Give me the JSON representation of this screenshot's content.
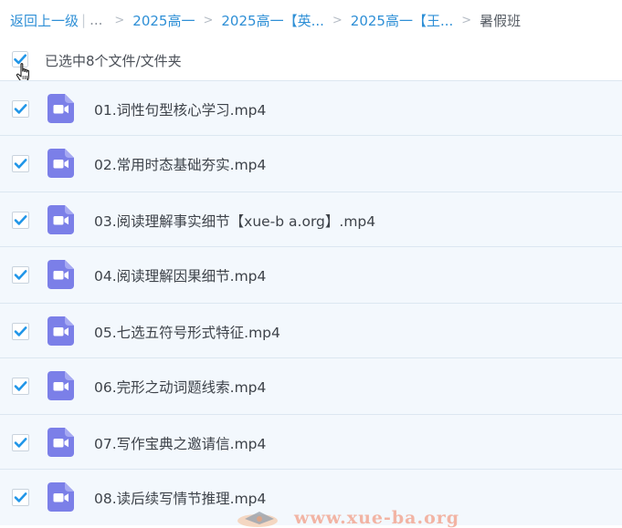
{
  "breadcrumb": {
    "back_label": "返回上一级",
    "separator": "|",
    "ellipsis": "...",
    "arrow": ">",
    "crumbs": [
      "2025高一",
      "2025高一【英...",
      "2025高一【王..."
    ],
    "current": "暑假班"
  },
  "selection": {
    "summary": "已选中8个文件/文件夹",
    "all_checked": true
  },
  "files": [
    {
      "name": "01.词性句型核心学习.mp4",
      "checked": true,
      "icon": "video-file-icon"
    },
    {
      "name": "02.常用时态基础夯实.mp4",
      "checked": true,
      "icon": "video-file-icon"
    },
    {
      "name": "03.阅读理解事实细节【xue-b a.org】.mp4",
      "checked": true,
      "icon": "video-file-icon"
    },
    {
      "name": "04.阅读理解因果细节.mp4",
      "checked": true,
      "icon": "video-file-icon"
    },
    {
      "name": "05.七选五符号形式特征.mp4",
      "checked": true,
      "icon": "video-file-icon"
    },
    {
      "name": "06.完形之动词题线索.mp4",
      "checked": true,
      "icon": "video-file-icon"
    },
    {
      "name": "07.写作宝典之邀请信.mp4",
      "checked": true,
      "icon": "video-file-icon"
    },
    {
      "name": "08.读后续写情节推理.mp4",
      "checked": true,
      "icon": "video-file-icon"
    }
  ],
  "watermark": "www.xue-ba.org",
  "colors": {
    "link": "#2e8fd6",
    "checkbox": "#2196e8",
    "video_icon": "#7b7fe8",
    "row_background": "#f3f8fd"
  }
}
